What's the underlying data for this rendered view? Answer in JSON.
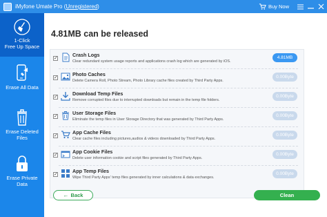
{
  "window": {
    "app_name": "iMyfone Umate Pro",
    "registration_status": "Unregistered",
    "buy_now": "Buy Now",
    "icons": [
      "app-logo-icon",
      "cart-icon",
      "menu-icon",
      "minimize-icon",
      "close-icon"
    ]
  },
  "sidebar": {
    "items": [
      {
        "label_line1": "1-Click",
        "label_line2": "Free Up Space",
        "icon": "broom-icon",
        "active": true
      },
      {
        "label_line1": "Erase All Data",
        "label_line2": "",
        "icon": "phone-erase-icon",
        "active": false
      },
      {
        "label_line1": "Erase Deleted",
        "label_line2": "Files",
        "icon": "trash-icon",
        "active": false
      },
      {
        "label_line1": "Erase Private",
        "label_line2": "Data",
        "icon": "lock-icon",
        "active": false
      }
    ]
  },
  "main": {
    "heading": "4.81MB can be released",
    "rows": [
      {
        "title": "Crash Logs",
        "desc": "Clear redundant system usage reports and applications crash log which are generated by iOS.",
        "size": "4.81MB",
        "checked": true,
        "highlight": true,
        "icon": "document-icon"
      },
      {
        "title": "Photo Caches",
        "desc": "Delete Camera Roll, Photo Stream, Photo Library cache files created by Third Party Apps.",
        "size": "0.00Byte",
        "checked": true,
        "highlight": false,
        "icon": "image-icon"
      },
      {
        "title": "Download Temp Files",
        "desc": "Remove corrupted files due to interrupted downloads but remain in the temp file folders.",
        "size": "0.00Byte",
        "checked": true,
        "highlight": false,
        "icon": "download-icon"
      },
      {
        "title": "User Storage Files",
        "desc": "Eliminate the temp files in User Storage Directory that was generated by Third Party Apps.",
        "size": "0.00Byte",
        "checked": true,
        "highlight": false,
        "icon": "trash-icon"
      },
      {
        "title": "App Cache Files",
        "desc": "Clear cache files including pictures,audios & videos downloaded by Third Party Apps.",
        "size": "0.00Byte",
        "checked": true,
        "highlight": false,
        "icon": "cart-icon"
      },
      {
        "title": "App Cookie Files",
        "desc": "Delete user information cookie and script files generated by Third Party Apps.",
        "size": "0.00Byte",
        "checked": true,
        "highlight": false,
        "icon": "cookie-icon"
      },
      {
        "title": "App Temp Files",
        "desc": "Wipe Third Party Apps' temp files generated by inner calculations & data exchanges.",
        "size": "0.00Byte",
        "checked": true,
        "highlight": false,
        "icon": "apps-icon"
      }
    ],
    "back_label": "Back",
    "clean_label": "Clean"
  },
  "colors": {
    "accent": "#2e8ee8",
    "sidebar": "#1b86ea",
    "sidebar_active": "#0c62c9",
    "clean_button": "#34b04f",
    "size_pill": "#3a98f2"
  }
}
